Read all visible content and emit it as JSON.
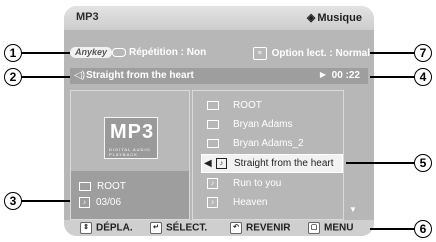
{
  "header": {
    "left_title": "MP3",
    "right_title": "Musique"
  },
  "info": {
    "anykey": "Anykey",
    "repeat_label": "Répétition : Non",
    "option_label": "Option lect. : Normal"
  },
  "now_playing": {
    "title": "Straight from the heart",
    "time": "00 :22"
  },
  "left_panel": {
    "logo_big": "MP3",
    "logo_small": "DIGITAL AUDIO PLAYBACK",
    "folder": "ROOT",
    "track_count": "03/06"
  },
  "file_list": [
    {
      "type": "folder",
      "label": "ROOT"
    },
    {
      "type": "folder",
      "label": "Bryan Adams"
    },
    {
      "type": "folder",
      "label": "Bryan Adams_2"
    },
    {
      "type": "track",
      "label": "Straight from the heart",
      "selected": true
    },
    {
      "type": "track",
      "label": "Run to you"
    },
    {
      "type": "track",
      "label": "Heaven"
    }
  ],
  "bottom_bar": {
    "move": "DÉPLA.",
    "select": "SÉLECT.",
    "back": "REVENIR",
    "menu": "MENU"
  },
  "callouts": [
    "1",
    "2",
    "3",
    "4",
    "5",
    "6",
    "7"
  ]
}
